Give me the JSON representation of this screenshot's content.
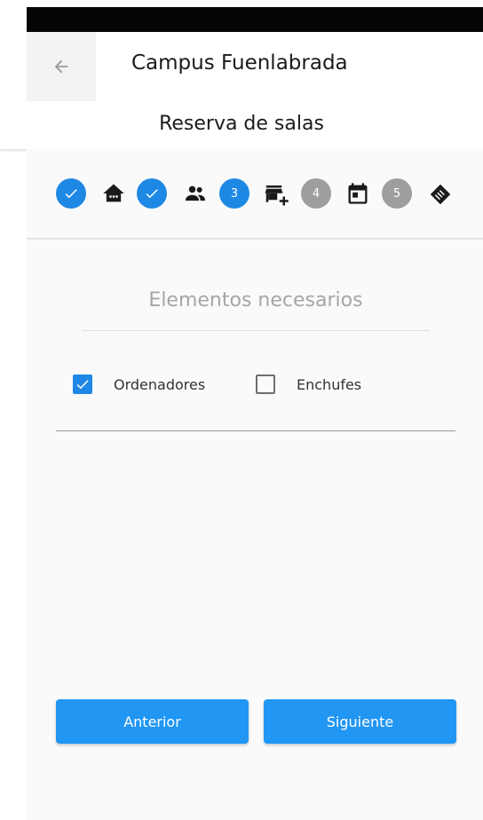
{
  "app_bar": {
    "title": "Campus Fuenlabrada"
  },
  "subtitle": "Reserva de salas",
  "stepper": {
    "steps": [
      {
        "status": "completed",
        "label": "",
        "icon": "home-icon"
      },
      {
        "status": "completed",
        "label": "",
        "icon": "people-icon"
      },
      {
        "status": "active",
        "label": "3",
        "icon": "store-add-icon"
      },
      {
        "status": "pending",
        "label": "4",
        "icon": "calendar-icon"
      },
      {
        "status": "pending",
        "label": "5",
        "icon": "handshake-icon"
      }
    ],
    "colors": {
      "active": "#1e88e5",
      "pending": "#9e9e9e"
    }
  },
  "form": {
    "section_title": "Elementos necesarios",
    "options": [
      {
        "label": "Ordenadores",
        "checked": true
      },
      {
        "label": "Enchufes",
        "checked": false
      }
    ]
  },
  "buttons": {
    "previous": "Anterior",
    "next": "Siguiente",
    "color": "#2196f3"
  }
}
